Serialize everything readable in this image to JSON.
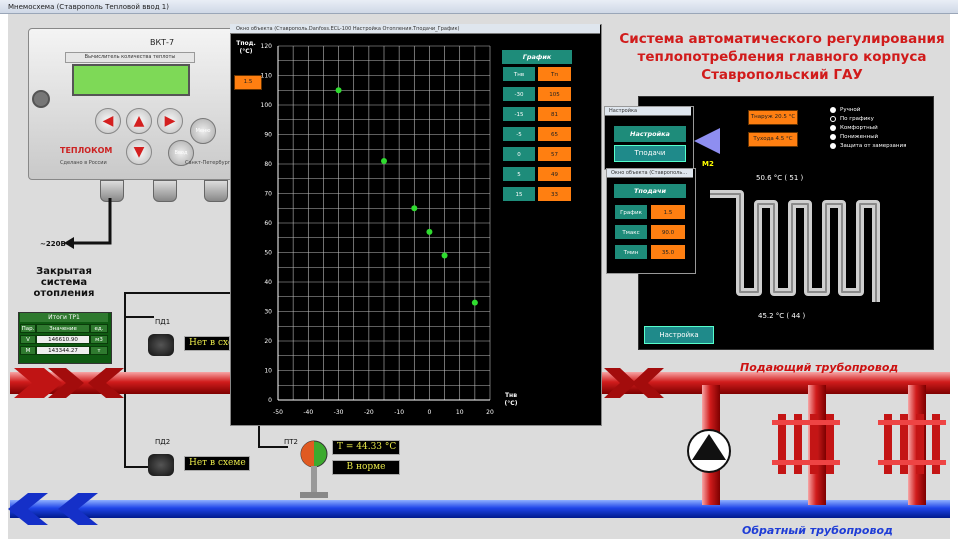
{
  "window_title": "Мнемосхема (Ставрополь Тепловой ввод 1)",
  "main_title": [
    "Система автоматического регулирования",
    "теплопотребления главного корпуса",
    "Ставропольский ГАУ"
  ],
  "device": {
    "model": "ВКТ-7",
    "screen_label": "Вычислитель количества теплоты",
    "brand": "ТЕПЛОКОМ",
    "caption": "Сделано в России",
    "caption2": "Санкт-Петербург",
    "btn_left": "Меню",
    "btn_right": "Ввод"
  },
  "power_label": "~220В",
  "system_label": [
    "Закрытая",
    "система",
    "отопления"
  ],
  "totals_table": {
    "title": "Итоги ТР1",
    "headers": [
      "Пар.",
      "Значение",
      "ед."
    ],
    "rows": [
      [
        "V",
        "146610.90",
        "м3"
      ],
      [
        "M",
        "143344.27",
        "т"
      ]
    ]
  },
  "pd1": {
    "label": "ПД1",
    "status": "Нет в схеме"
  },
  "pd2": {
    "label": "ПД2",
    "status": "Нет в схеме"
  },
  "pt2": {
    "label": "ПТ2",
    "reading": "T = 44.33 °C",
    "status": "В норме"
  },
  "supply_label": "Подающий трубопровод",
  "return_label": "Обратный трубопровод",
  "graph_window": {
    "title": "Окно объекта (Ставрополь.Danfoss.ECL-100 Настройка Отопления.Тподачи_График)",
    "y_axis_title": [
      "Тпод.",
      "(°С)"
    ],
    "x_axis_title": [
      "Тнв",
      "(°С)"
    ],
    "chip_value": "1.5",
    "graph_header": "График",
    "table_headers": [
      "Тнв",
      "Тп"
    ],
    "table_rows": [
      [
        "-30",
        "105"
      ],
      [
        "-15",
        "81"
      ],
      [
        "-5",
        "65"
      ],
      [
        "0",
        "57"
      ],
      [
        "5",
        "49"
      ],
      [
        "15",
        "33"
      ]
    ]
  },
  "chart_data": {
    "type": "scatter",
    "x": [
      -30,
      -15,
      -5,
      0,
      5,
      15
    ],
    "y": [
      105,
      81,
      65,
      57,
      49,
      33
    ],
    "xlim": [
      -50,
      20
    ],
    "ylim": [
      0,
      120
    ],
    "xticks": [
      "-50",
      "-40",
      "-30",
      "-20",
      "-10",
      "0",
      "10",
      "20"
    ],
    "yticks": [
      "0",
      "10",
      "20",
      "30",
      "40",
      "50",
      "60",
      "70",
      "80",
      "90",
      "100",
      "110",
      "120"
    ],
    "grid": true,
    "point_color": "#2fdc2f"
  },
  "settings_window": {
    "title": "Настройка",
    "head": "Настройка",
    "btn": "Тподачи"
  },
  "tpod_window": {
    "title": "Окно объекта (Ставрополь...",
    "head": "Тподачи",
    "rows": [
      [
        "График",
        "1.5"
      ],
      [
        "Тмакс",
        "90.0"
      ],
      [
        "Тмин",
        "35.0"
      ]
    ]
  },
  "right_panel": {
    "t_outdoor": "Тнаруж 20.5 °C",
    "t_room": "Тухода 4.5 °C",
    "modes": [
      "Ручной",
      "По графику",
      "Комфортный",
      "Пониженный",
      "Защита от замерзания"
    ],
    "selected_mode": 1,
    "top_temp": "50.6 °C  ( 51 )",
    "bottom_temp": "45.2 °C  ( 44 )",
    "setup_btn": "Настройка",
    "valve_label": "М2"
  },
  "colors": {
    "supply": "#d11c1c",
    "return": "#1f45e8",
    "accent": "#ff7f11",
    "teal": "#1e8c7a"
  }
}
